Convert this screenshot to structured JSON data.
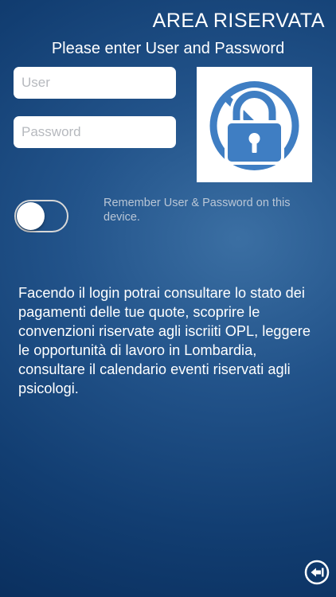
{
  "header": {
    "title": "AREA RISERVATA",
    "subtitle": "Please enter User and Password"
  },
  "form": {
    "user_placeholder": "User",
    "user_value": "",
    "password_placeholder": "Password",
    "password_value": "",
    "remember_toggle_on": false,
    "remember_label": "Remember User & Password on this device."
  },
  "info_text": "Facendo il login potrai consultare lo stato dei pagamenti delle tue quote, scoprire le convenzioni riservate agli iscriiti OPL, leggere le opportunità di lavoro in Lombardia, consultare il calendario eventi riservati agli psicologi.",
  "icons": {
    "lock": "crossed-lock-icon",
    "back": "back-arrow-icon"
  },
  "colors": {
    "accent_blue": "#3f7ec3",
    "background_dark": "#0a2f5e",
    "background_light": "#3b6fa3"
  }
}
